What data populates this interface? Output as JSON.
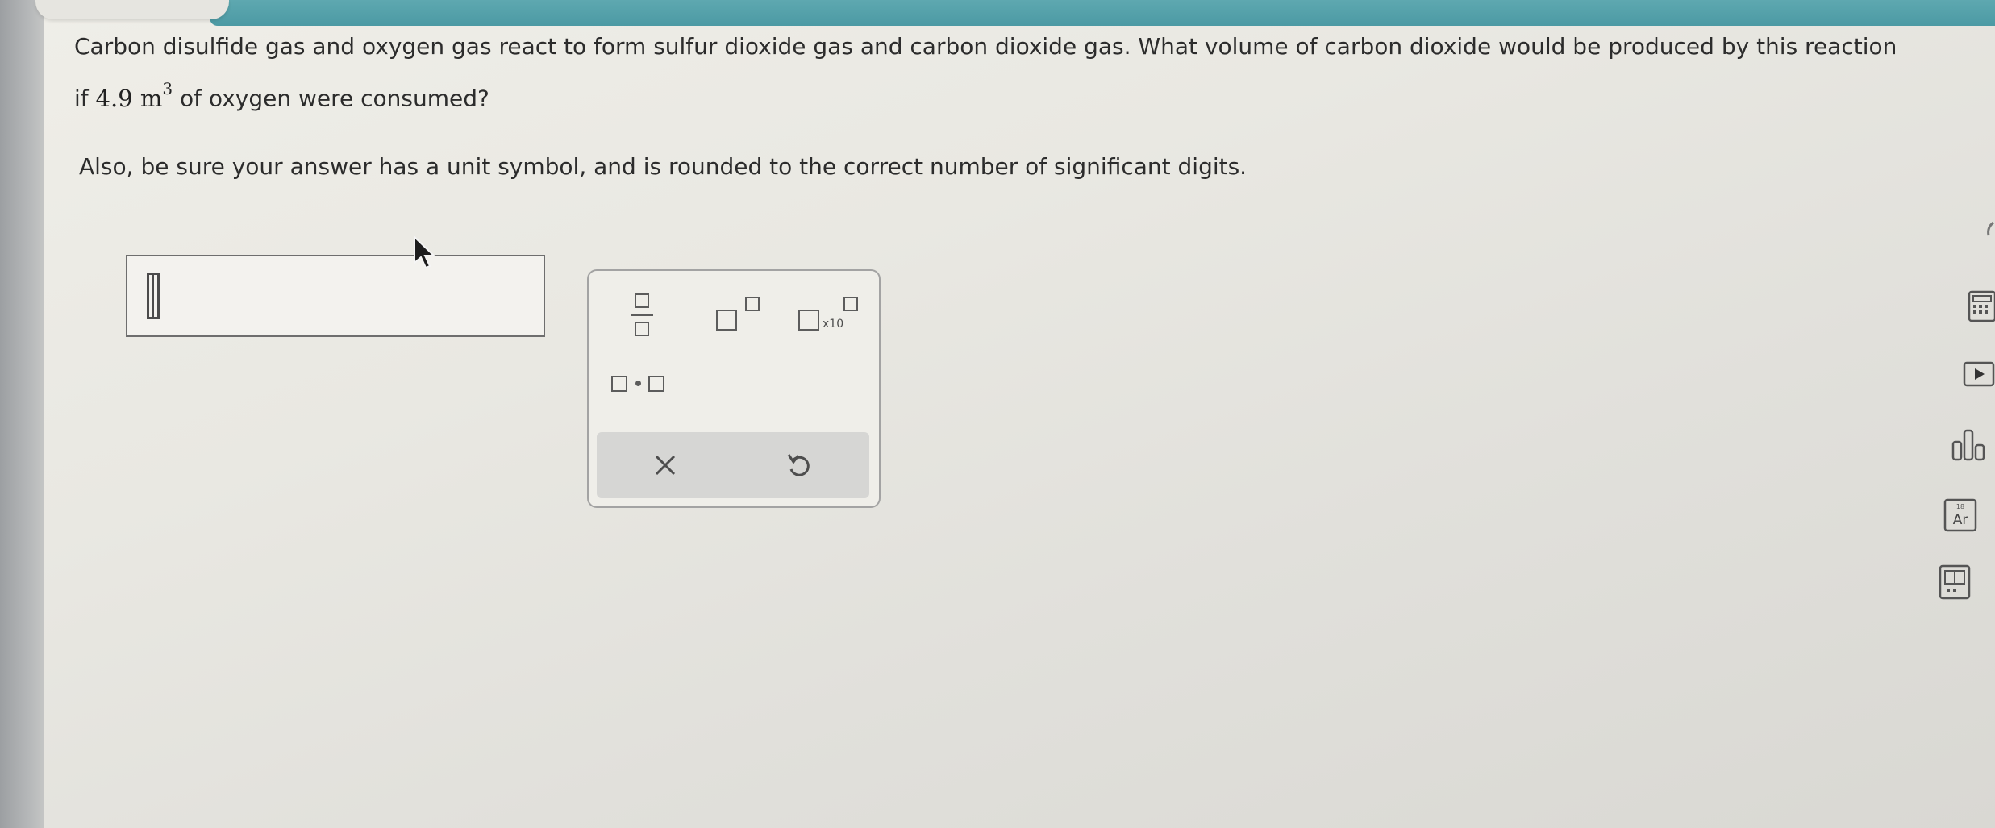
{
  "question": {
    "line1": "Carbon disulfide gas and oxygen gas react to form sulfur dioxide gas and carbon dioxide gas. What volume of carbon dioxide would be produced by this reaction",
    "line2_prefix": "if",
    "quantity_value": "4.9",
    "quantity_unit": "m",
    "quantity_exponent": "3",
    "line2_suffix": "of oxygen were consumed?"
  },
  "instructions": "Also, be sure your answer has a unit symbol, and is rounded to the correct number of significant digits.",
  "answer": {
    "value": ""
  },
  "toolbox": {
    "sci_label": "x10",
    "tools": [
      "fraction-icon",
      "exponent-icon",
      "scientific-notation-icon",
      "multiplication-dot-icon"
    ],
    "clear_icon": "close-icon",
    "undo_icon": "undo-icon"
  },
  "sidebar": {
    "icons": [
      "calculator-icon",
      "video-icon",
      "bar-chart-icon",
      "periodic-table-icon",
      "reference-icon"
    ]
  },
  "colors": {
    "top_bar": "#4c9aa4",
    "text": "#2c2c2c",
    "border": "#6e6e6e"
  }
}
